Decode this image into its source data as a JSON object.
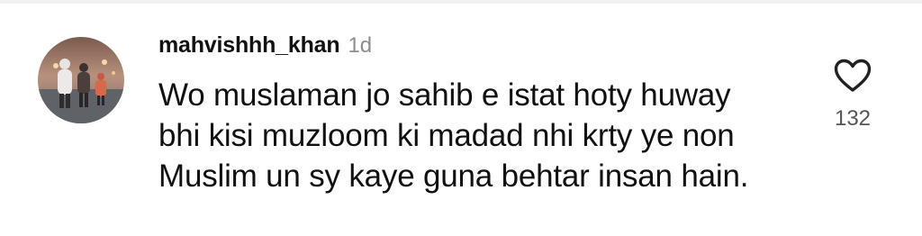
{
  "comment": {
    "username": "mahvishhh_khan",
    "timestamp": "1d",
    "text": "Wo muslaman jo sahib e istat hoty huway bhi kisi muzloom ki madad nhi krty ye non Muslim un sy kaye guna behtar insan hain.",
    "like_count": "132",
    "like_icon": "heart-outline-icon"
  },
  "colors": {
    "text": "#111111",
    "secondary_text": "#8e8e8e",
    "like_count": "#555555",
    "background": "#ffffff"
  }
}
